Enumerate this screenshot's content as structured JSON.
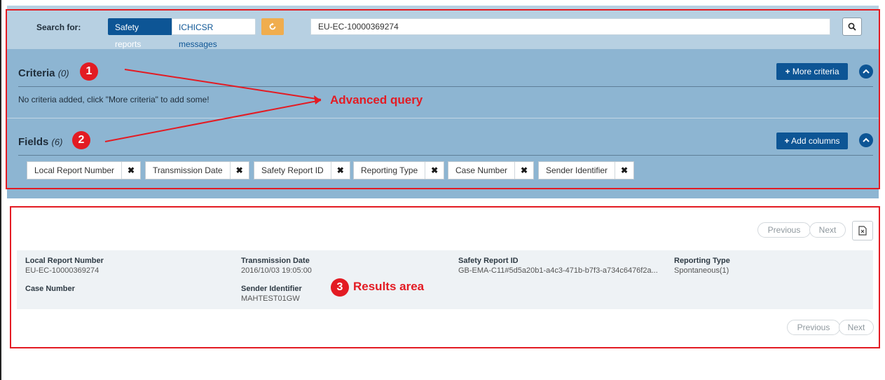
{
  "search": {
    "label": "Search for:",
    "toggle_safety": "Safety reports",
    "toggle_ichicsr": "ICHICSR messages",
    "reset_icon": "refresh-icon",
    "query_value": "EU-EC-10000369274",
    "button_icon": "search-icon"
  },
  "criteria": {
    "title": "Criteria",
    "count": "(0)",
    "more_button": "More criteria",
    "empty_text": "No criteria added, click \"More criteria\" to add some!",
    "collapse_icon": "chevron-up-icon"
  },
  "fields": {
    "title": "Fields",
    "count": "(6)",
    "add_button": "Add columns",
    "chips": [
      "Local Report Number",
      "Transmission Date",
      "Safety Report ID",
      "Reporting Type",
      "Case Number",
      "Sender Identifier"
    ],
    "remove_icon": "close-icon"
  },
  "results": {
    "pager_previous": "Previous",
    "pager_next": "Next",
    "export_icon": "export-file-icon",
    "row": {
      "local_report_number_label": "Local Report Number",
      "local_report_number": "EU-EC-10000369274",
      "case_number_label": "Case Number",
      "transmission_date_label": "Transmission Date",
      "transmission_date": "2016/10/03 19:05:00",
      "sender_identifier_label": "Sender Identifier",
      "sender_identifier": "MAHTEST01GW",
      "safety_report_id_label": "Safety Report ID",
      "safety_report_id": "GB-EMA-C11#5d5a20b1-a4c3-471b-b7f3-a734c6476f2a...",
      "reporting_type_label": "Reporting Type",
      "reporting_type": "Spontaneous(1)"
    }
  },
  "annotations": {
    "marker_1": "1",
    "marker_2": "2",
    "marker_3": "3",
    "advanced_query": "Advanced query",
    "results_area": "Results area",
    "color": "#e31b23"
  },
  "colors": {
    "panel": "#8db5d2",
    "search_bar": "#b7d0e2",
    "primary": "#0d5595",
    "reset": "#f0ad4e"
  }
}
